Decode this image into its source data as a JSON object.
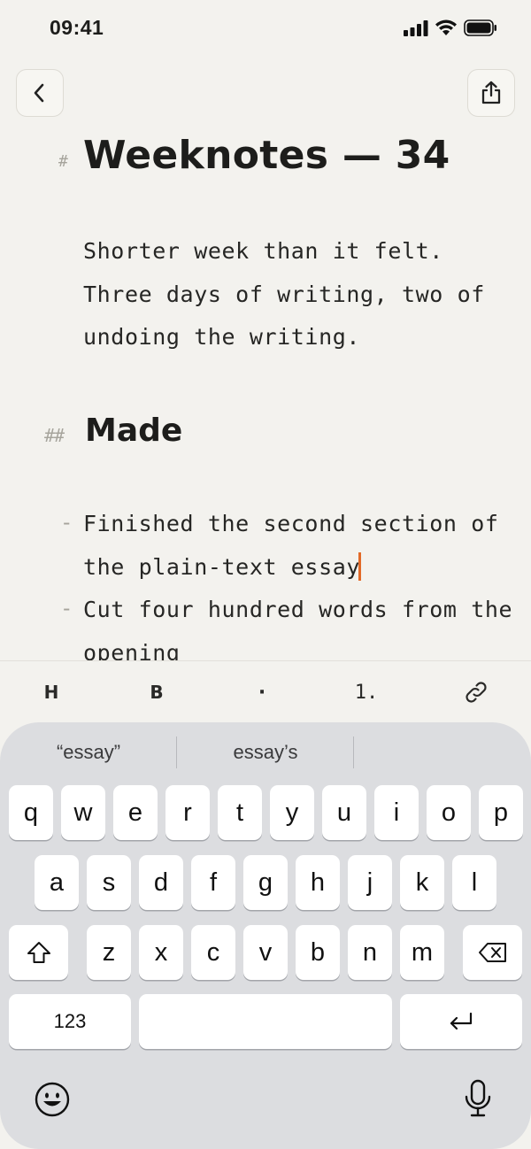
{
  "status_bar": {
    "time": "09:41"
  },
  "header": {
    "back_icon": "chevron-left-icon",
    "share_icon": "share-icon"
  },
  "document": {
    "h1_marker": "#",
    "title": "Weeknotes — 34",
    "intro": "Shorter week than it felt. Three days of writing, two of undoing the writing.",
    "h2_marker": "##",
    "section_title": "Made",
    "list_marker": "-",
    "items": [
      {
        "text": "Finished the second section of the plain-text essay"
      },
      {
        "text": "Cut four hundred words from the opening"
      }
    ]
  },
  "toolbar": {
    "heading": "H",
    "bold": "B",
    "bullet": "·",
    "numbered": "1.",
    "link_icon": "link-icon"
  },
  "keyboard": {
    "suggestions": [
      "“essay”",
      "essay’s",
      ""
    ],
    "row1": [
      "q",
      "w",
      "e",
      "r",
      "t",
      "y",
      "u",
      "i",
      "o",
      "p"
    ],
    "row2": [
      "a",
      "s",
      "d",
      "f",
      "g",
      "h",
      "j",
      "k",
      "l"
    ],
    "row3": [
      "z",
      "x",
      "c",
      "v",
      "b",
      "n",
      "m"
    ],
    "numbers_key": "123",
    "shift_icon": "shift-icon",
    "delete_icon": "delete-icon",
    "return_icon": "return-icon",
    "emoji_icon": "emoji-icon",
    "mic_icon": "microphone-icon"
  },
  "colors": {
    "caret": "#e26a28",
    "background": "#f3f2ee",
    "keyboard": "#dcdde0"
  }
}
